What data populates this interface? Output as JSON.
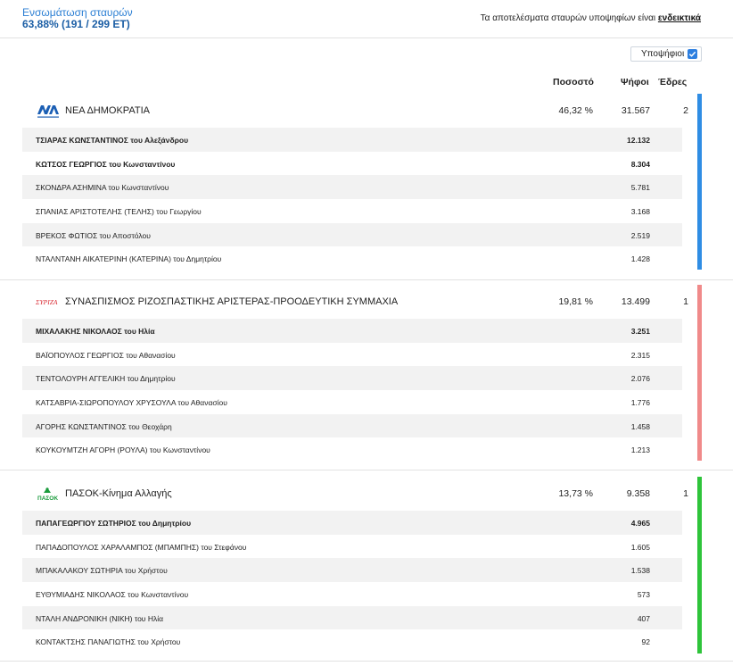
{
  "header": {
    "integration_label": "Ενσωμάτωση σταυρών",
    "integration_value": "63,88% (191 / 299 ΕΤ)",
    "note_text": "Τα αποτελέσματα σταυρών υποψηφίων είναι ",
    "note_link": "ενδεικτικά"
  },
  "toggle": {
    "label": "Υποψήφιοι",
    "checked": true
  },
  "columns": {
    "percent": "Ποσοστό",
    "votes": "Ψήφοι",
    "seats": "Έδρες"
  },
  "parties": [
    {
      "name": "ΝΕΑ ΔΗΜΟΚΡΑΤΙΑ",
      "logo": "nd-logo",
      "percent": "46,32 %",
      "votes": "31.567",
      "seats": "2",
      "color": "#2f8de4",
      "candidates": [
        {
          "name": "ΤΣΙΑΡΑΣ ΚΩΝΣΤΑΝΤΙΝΟΣ του Αλεξάνδρου",
          "votes": "12.132"
        },
        {
          "name": "ΚΩΤΣΟΣ ΓΕΩΡΓΙΟΣ του Κωνσταντίνου",
          "votes": "8.304"
        },
        {
          "name": "ΣΚΟΝΔΡΑ ΑΣΗΜΙΝΑ του Κωνσταντίνου",
          "votes": "5.781"
        },
        {
          "name": "ΣΠΑΝΙΑΣ ΑΡΙΣΤΟΤΕΛΗΣ (ΤΕΛΗΣ) του Γεωργίου",
          "votes": "3.168"
        },
        {
          "name": "ΒΡΕΚΟΣ ΦΩΤΙΟΣ του Αποστόλου",
          "votes": "2.519"
        },
        {
          "name": "ΝΤΑΛΝΤΑΝΗ ΑΙΚΑΤΕΡΙΝΗ (ΚΑΤΕΡΙΝΑ) του Δημητρίου",
          "votes": "1.428"
        }
      ]
    },
    {
      "name": "ΣΥΝΑΣΠΙΣΜΟΣ ΡΙΖΟΣΠΑΣΤΙΚΗΣ ΑΡΙΣΤΕΡΑΣ-ΠΡΟΟΔΕΥΤΙΚΗ ΣΥΜΜΑΧΙΑ",
      "logo": "syriza-logo",
      "logo_text": "ΣΥΡΙΖΑ",
      "percent": "19,81 %",
      "votes": "13.499",
      "seats": "1",
      "color": "#f08a8a",
      "candidates": [
        {
          "name": "ΜΙΧΑΛΑΚΗΣ ΝΙΚΟΛΑΟΣ του Ηλία",
          "votes": "3.251"
        },
        {
          "name": "ΒΑΪΟΠΟΥΛΟΣ ΓΕΩΡΓΙΟΣ του Αθανασίου",
          "votes": "2.315"
        },
        {
          "name": "ΤΕΝΤΟΛΟΥΡΗ ΑΓΓΕΛΙΚΗ του Δημητρίου",
          "votes": "2.076"
        },
        {
          "name": "ΚΑΤΣΑΒΡΙΑ-ΣΙΩΡΟΠΟΥΛΟΥ ΧΡΥΣΟΥΛΑ του Αθανασίου",
          "votes": "1.776"
        },
        {
          "name": "ΑΓΟΡΗΣ ΚΩΝΣΤΑΝΤΙΝΟΣ του Θεοχάρη",
          "votes": "1.458"
        },
        {
          "name": "ΚΟΥΚΟΥΜΤΖΗ ΑΓΟΡΗ (ΡΟΥΛΑ) του Κωνσταντίνου",
          "votes": "1.213"
        }
      ]
    },
    {
      "name": "ΠΑΣΟΚ-Κίνημα Αλλαγής",
      "logo": "pasok-logo",
      "logo_text": "ΠΑΣΟΚ",
      "percent": "13,73 %",
      "votes": "9.358",
      "seats": "1",
      "color": "#2ec43a",
      "candidates": [
        {
          "name": "ΠΑΠΑΓΕΩΡΓΙΟΥ ΣΩΤΗΡΙΟΣ του Δημητρίου",
          "votes": "4.965"
        },
        {
          "name": "ΠΑΠΑΔΟΠΟΥΛΟΣ ΧΑΡΑΛΑΜΠΟΣ (ΜΠΑΜΠΗΣ) του Στεφάνου",
          "votes": "1.605"
        },
        {
          "name": "ΜΠΑΚΑΛΑΚΟΥ ΣΩΤΗΡΙΑ του Χρήστου",
          "votes": "1.538"
        },
        {
          "name": "ΕΥΘΥΜΙΑΔΗΣ ΝΙΚΟΛΑΟΣ του Κωνσταντίνου",
          "votes": "573"
        },
        {
          "name": "ΝΤΑΛΗ ΑΝΔΡΟΝΙΚΗ (ΝΙΚΗ) του Ηλία",
          "votes": "407"
        },
        {
          "name": "ΚΟΝΤΑΚΤΣΗΣ ΠΑΝΑΓΙΩΤΗΣ του Χρήστου",
          "votes": "92"
        }
      ]
    }
  ]
}
